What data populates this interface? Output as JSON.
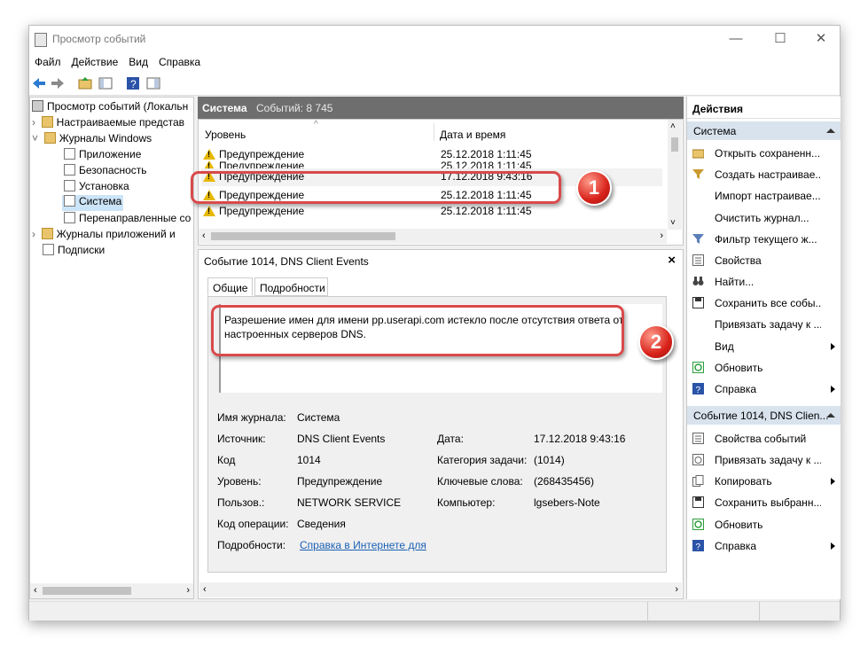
{
  "window": {
    "title": "Просмотр событий",
    "minimize": "—",
    "maximize": "☐",
    "close": "✕"
  },
  "menu": [
    "Файл",
    "Действие",
    "Вид",
    "Справка"
  ],
  "tree": {
    "root": "Просмотр событий (Локальн",
    "items": [
      "Настраиваемые представ",
      "Журналы Windows",
      "Приложение",
      "Безопасность",
      "Установка",
      "Система",
      "Перенаправленные со",
      "Журналы приложений и",
      "Подписки"
    ],
    "selected": "Система"
  },
  "list_header": {
    "name": "Система",
    "count": "Событий: 8 745"
  },
  "columns": {
    "level": "Уровень",
    "date": "Дата и время"
  },
  "events": [
    {
      "level": "Предупреждение",
      "date": "25.12.2018 1:11:45"
    },
    {
      "level": "Предупреждение",
      "date": "25.12.2018 1:11:45"
    },
    {
      "level": "Предупреждение",
      "date": "17.12.2018 9:43:16"
    },
    {
      "level": "Предупреждение",
      "date": "25.12.2018 1:11:45"
    },
    {
      "level": "Предупреждение",
      "date": "25.12.2018 1:11:45"
    }
  ],
  "detail": {
    "title": "Событие 1014, DNS Client Events",
    "tabs": [
      "Общие",
      "Подробности"
    ],
    "message": "Разрешение имен для имени pp.userapi.com истекло после отсутствия ответа от настроенных серверов DNS.",
    "fields": {
      "log_label": "Имя журнала:",
      "log": "Система",
      "source_label": "Источник:",
      "source": "DNS Client Events",
      "date_label": "Дата:",
      "date": "17.12.2018 9:43:16",
      "code_label": "Код",
      "code": "1014",
      "category_label": "Категория задачи:",
      "category": "(1014)",
      "level_label": "Уровень:",
      "level": "Предупреждение",
      "keywords_label": "Ключевые слова:",
      "keywords": "(268435456)",
      "user_label": "Пользов.:",
      "user": "NETWORK SERVICE",
      "computer_label": "Компьютер:",
      "computer": "lgsebers-Note",
      "opcode_label": "Код операции:",
      "opcode": "Сведения",
      "more_label": "Подробности:",
      "more_link": "Справка в Интернете для"
    }
  },
  "callouts": {
    "one": "1",
    "two": "2"
  },
  "actions": {
    "title": "Действия",
    "section1": "Система",
    "items1": [
      "Открыть сохраненн...",
      "Создать настраивае...",
      "Импорт настраивае...",
      "Очистить журнал...",
      "Фильтр текущего ж...",
      "Свойства",
      "Найти...",
      "Сохранить все собы...",
      "Привязать задачу к ...",
      "Вид",
      "Обновить",
      "Справка"
    ],
    "section2": "Событие 1014, DNS Clien...",
    "items2": [
      "Свойства событий",
      "Привязать задачу к ...",
      "Копировать",
      "Сохранить выбранн...",
      "Обновить",
      "Справка"
    ]
  },
  "colors": {
    "highlight": "#d94a4a",
    "header_gray": "#6e6e6e",
    "section_blue": "#d9e3ee",
    "warning_yellow": "#e6b800"
  }
}
